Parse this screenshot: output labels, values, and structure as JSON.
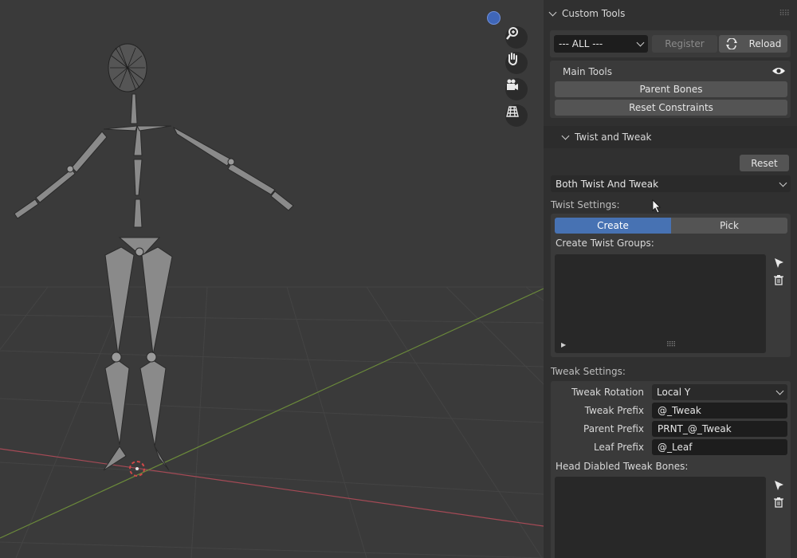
{
  "viewport": {
    "tools": [
      "zoom-icon",
      "hand-pan-icon",
      "camera-icon",
      "grid-icon"
    ]
  },
  "panel": {
    "header": {
      "title": "Custom Tools"
    },
    "filter_select": {
      "value": "--- ALL ---"
    },
    "register_label": "Register",
    "reload_label": "Reload",
    "main_tools": {
      "title": "Main Tools",
      "parent_bones_label": "Parent Bones",
      "reset_constraints_label": "Reset Constraints"
    },
    "twist_tweak": {
      "title": "Twist and Tweak",
      "reset_label": "Reset",
      "mode_select": {
        "value": "Both Twist And Tweak"
      },
      "twist_settings_label": "Twist Settings:",
      "tabs": [
        {
          "label": "Create",
          "active": true
        },
        {
          "label": "Pick",
          "active": false
        }
      ],
      "create_groups_label": "Create Twist Groups:",
      "tweak_settings_label": "Tweak Settings:",
      "tweak_rotation": {
        "label": "Tweak Rotation",
        "value": "Local Y"
      },
      "tweak_prefix": {
        "label": "Tweak Prefix",
        "value": "@_Tweak"
      },
      "parent_prefix": {
        "label": "Parent Prefix",
        "value": "PRNT_@_Tweak"
      },
      "leaf_prefix": {
        "label": "Leaf Prefix",
        "value": "@_Leaf"
      },
      "head_disabled_label": "Head Diabled Tweak Bones:"
    }
  },
  "colors": {
    "accent": "#4772b3",
    "panel_bg": "#303030",
    "viewport_bg": "#3a3a3a",
    "x_axis": "#a64a56",
    "y_axis": "#6b8a3a"
  }
}
